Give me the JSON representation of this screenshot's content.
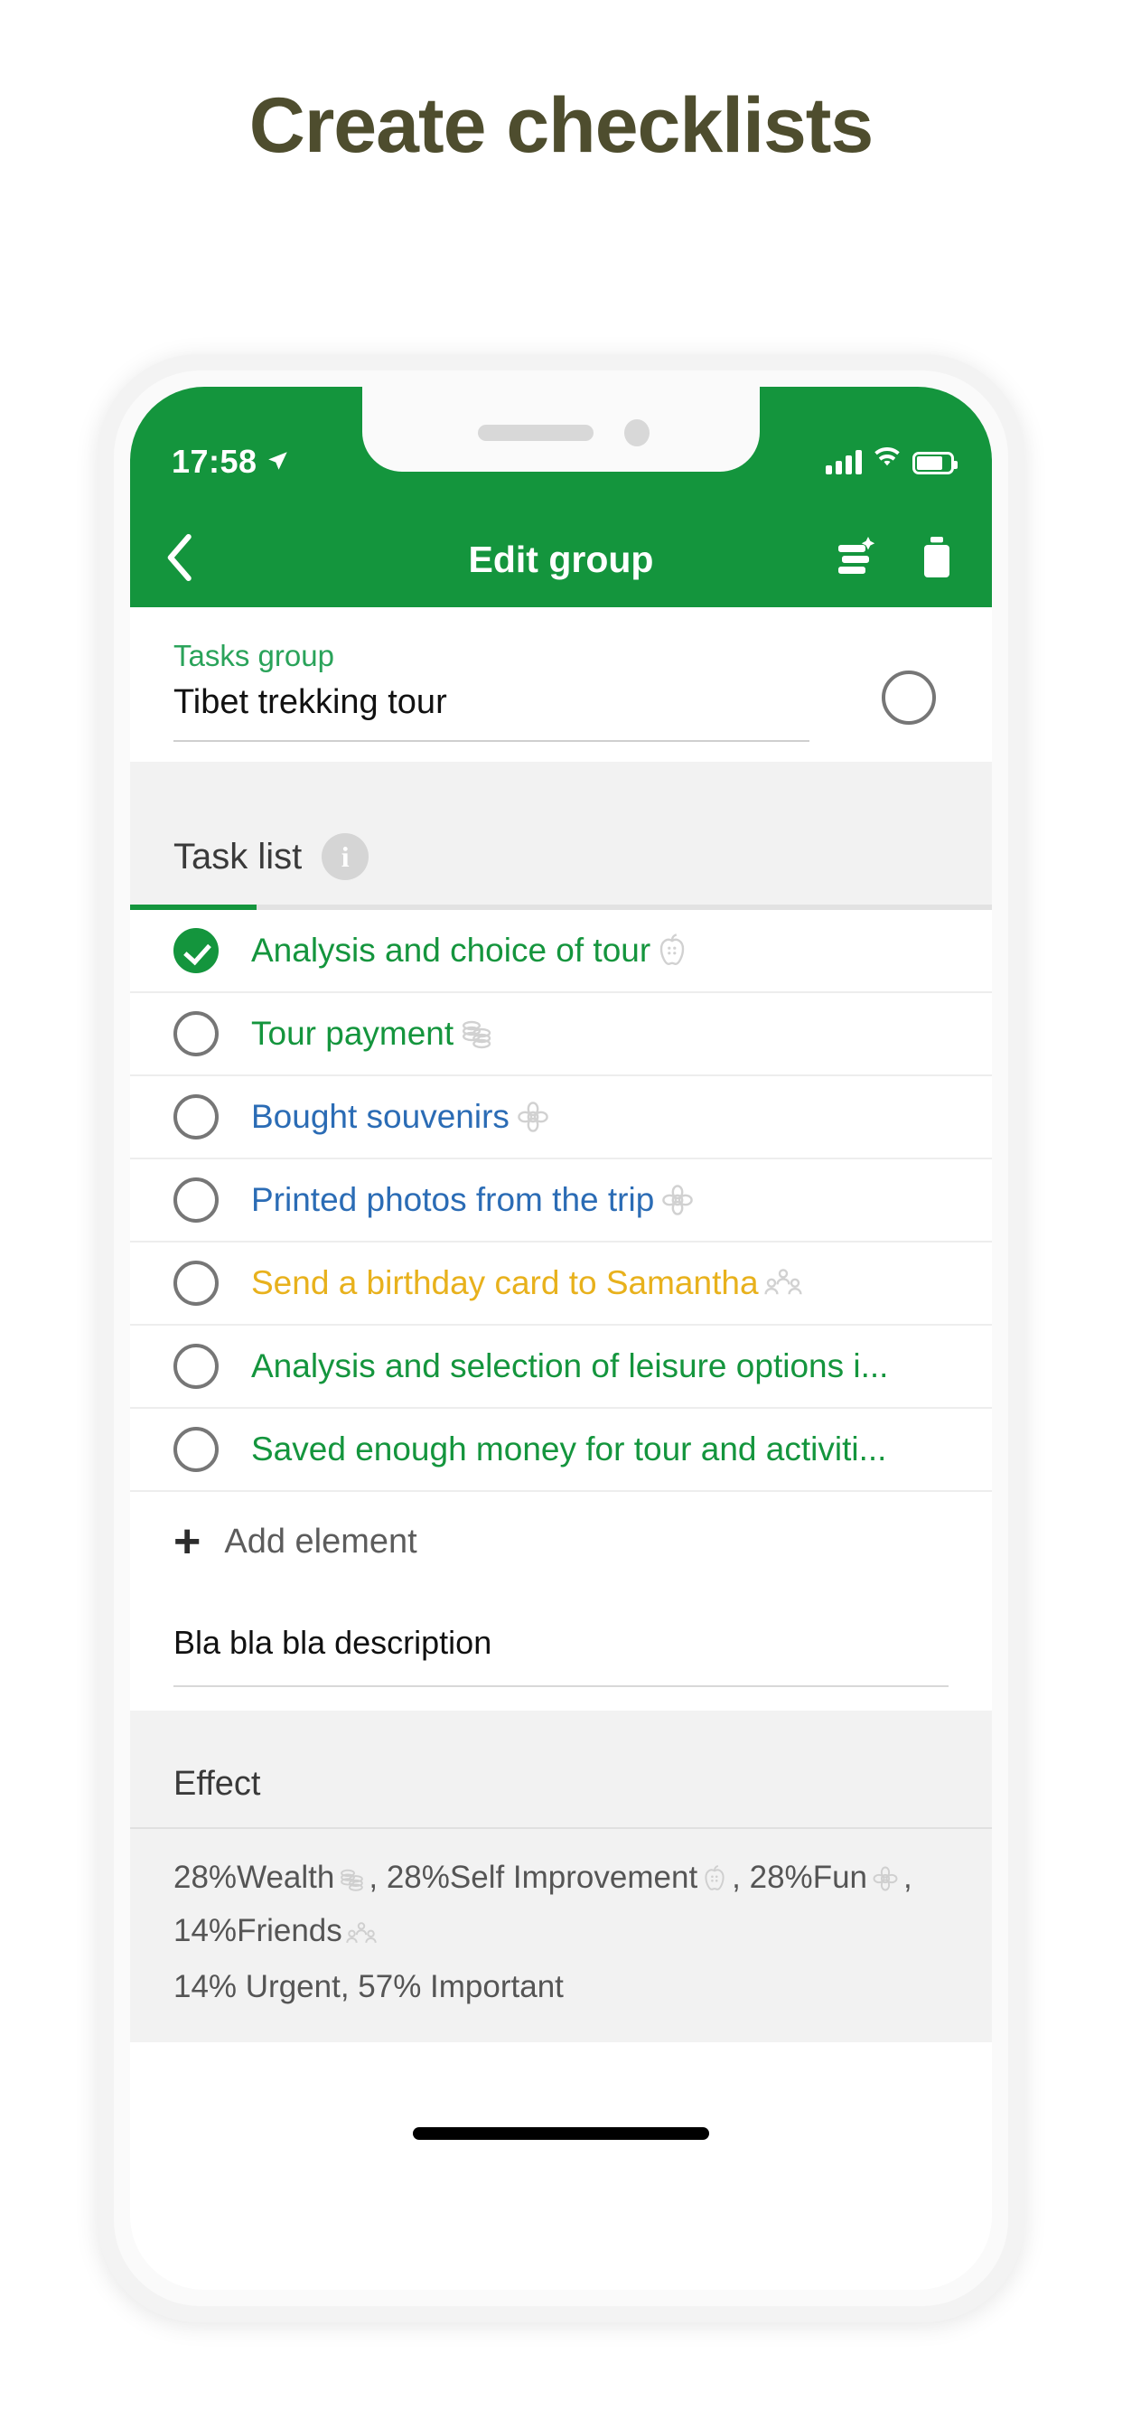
{
  "page": {
    "headline": "Create checklists"
  },
  "status_bar": {
    "time": "17:58",
    "location_icon": "location-arrow-icon",
    "signal_icon": "cellular-bars-icon",
    "wifi_icon": "wifi-icon",
    "battery_icon": "battery-icon"
  },
  "nav": {
    "back_icon": "chevron-left-icon",
    "title": "Edit group",
    "save_icon": "save-stack-icon",
    "delete_icon": "trash-icon"
  },
  "group": {
    "label": "Tasks group",
    "value": "Tibet trekking tour",
    "placeholder": "Tasks group",
    "checkbox_checked": false
  },
  "tab": {
    "label": "Task list",
    "info_badge": "i",
    "info_icon": "info-icon",
    "active": true
  },
  "tasks": [
    {
      "text": "Analysis and choice of tour",
      "done": true,
      "color": "#14953d",
      "icon": "apple-icon",
      "truncated": false
    },
    {
      "text": "Tour payment",
      "done": false,
      "color": "#14953d",
      "icon": "coins-icon",
      "truncated": false
    },
    {
      "text": "Bought souvenirs",
      "done": false,
      "color": "#2b6cb5",
      "icon": "flower-icon",
      "truncated": false
    },
    {
      "text": "Printed photos from the trip",
      "done": false,
      "color": "#2b6cb5",
      "icon": "flower-icon",
      "truncated": false
    },
    {
      "text": "Send a birthday card to Samantha",
      "done": false,
      "color": "#e8b11c",
      "icon": "friends-icon",
      "truncated": false
    },
    {
      "text": "Analysis and selection of leisure options i...",
      "done": false,
      "color": "#14953d",
      "icon": "none",
      "truncated": true
    },
    {
      "text": "Saved enough money for tour and activiti...",
      "done": false,
      "color": "#14953d",
      "icon": "none",
      "truncated": true
    }
  ],
  "add_element": {
    "plus_icon": "plus-icon",
    "label": "Add element"
  },
  "description": {
    "value": "Bla bla bla description"
  },
  "effect": {
    "heading": "Effect",
    "segments": [
      {
        "percent": "28%",
        "name": "Wealth",
        "icon": "coins-icon"
      },
      {
        "percent": "28%",
        "name": "Self Improvement",
        "icon": "apple-icon"
      },
      {
        "percent": "28%",
        "name": "Fun",
        "icon": "flower-icon"
      },
      {
        "percent": "14%",
        "name": "Friends",
        "icon": "friends-icon"
      }
    ],
    "line1": "28%Wealth , 28%Self Improvement , 28%Fun , 14%Friends",
    "line2": "14% Urgent, 57% Important"
  },
  "home_indicator": "home-bar",
  "colors": {
    "brand_green": "#14953d",
    "headline": "#4e4d2e",
    "blue_task": "#2b6cb5",
    "amber_task": "#e8b11c",
    "band_grey": "#f2f2f2"
  }
}
